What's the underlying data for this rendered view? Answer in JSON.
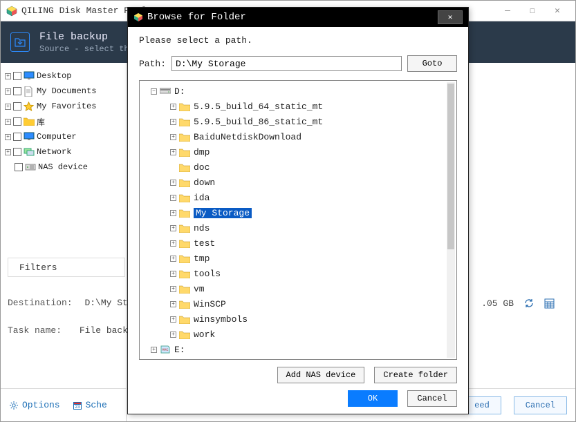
{
  "mainWindow": {
    "title": "QILING Disk Master Profe",
    "header": {
      "title": "File backup",
      "subtitle": "Source - select th"
    },
    "leftTree": [
      {
        "label": "Desktop",
        "iconColor": "#2d8cff",
        "expandable": true
      },
      {
        "label": "My Documents",
        "iconColor": "#fff",
        "expandable": true,
        "docIcon": true
      },
      {
        "label": "My Favorites",
        "iconColor": "#ffcc33",
        "expandable": true,
        "starIcon": true
      },
      {
        "label": "库",
        "iconColor": "#ffcc33",
        "expandable": true,
        "folderIcon": true
      },
      {
        "label": "Computer",
        "iconColor": "#2d8cff",
        "expandable": true
      },
      {
        "label": "Network",
        "iconColor": "#9be29b",
        "expandable": true,
        "netIcon": true
      },
      {
        "label": "NAS device",
        "iconColor": "#888",
        "expandable": false,
        "nasIcon": true
      }
    ],
    "filtersLabel": "Filters",
    "destinationLabel": "Destination:",
    "destinationValue": "D:\\My Stora",
    "taskNameLabel": "Task name:",
    "taskNameValue": "File backup",
    "sizeInfo": ".05 GB",
    "bottom": {
      "options": "Options",
      "schedule": "Sche",
      "proceed": "eed",
      "cancel": "Cancel"
    }
  },
  "modal": {
    "title": "Browse for Folder",
    "instruction": "Please select a path.",
    "pathLabel": "Path:",
    "pathValue": "D:\\My Storage",
    "gotoLabel": "Goto",
    "tree": {
      "rootDrive": "D:",
      "children": [
        {
          "label": "5.9.5_build_64_static_mt",
          "expandable": true
        },
        {
          "label": "5.9.5_build_86_static_mt",
          "expandable": true
        },
        {
          "label": "BaiduNetdiskDownload",
          "expandable": true
        },
        {
          "label": "dmp",
          "expandable": true
        },
        {
          "label": "doc",
          "expandable": false
        },
        {
          "label": "down",
          "expandable": true
        },
        {
          "label": "ida",
          "expandable": true
        },
        {
          "label": "My Storage",
          "expandable": true,
          "selected": true
        },
        {
          "label": "nds",
          "expandable": true
        },
        {
          "label": "test",
          "expandable": true
        },
        {
          "label": "tmp",
          "expandable": true
        },
        {
          "label": "tools",
          "expandable": true
        },
        {
          "label": "vm",
          "expandable": true
        },
        {
          "label": "WinSCP",
          "expandable": true
        },
        {
          "label": "winsymbols",
          "expandable": true
        },
        {
          "label": "work",
          "expandable": true
        }
      ],
      "siblingDrive": "E:"
    },
    "addNas": "Add NAS device",
    "createFolder": "Create folder",
    "ok": "OK",
    "cancel": "Cancel"
  }
}
